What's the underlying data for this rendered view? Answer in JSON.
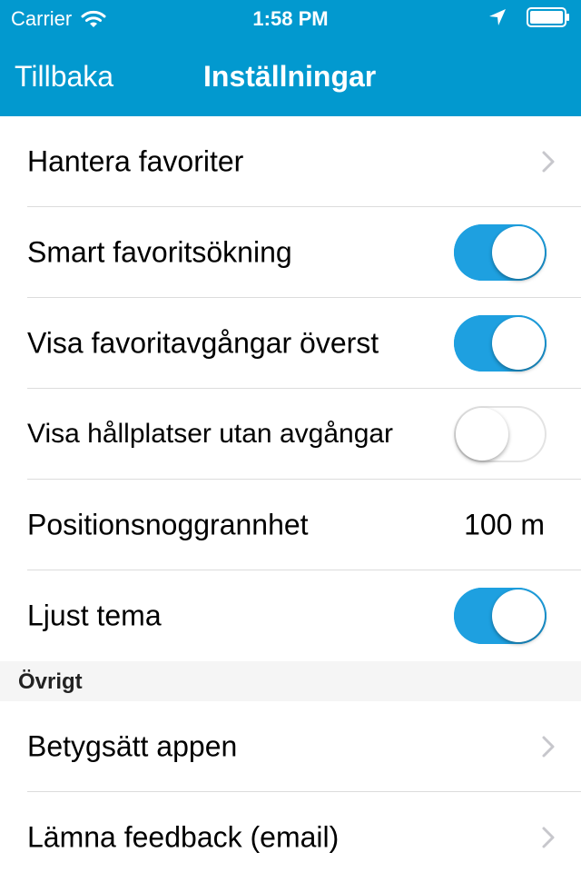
{
  "status_bar": {
    "carrier": "Carrier",
    "time": "1:58 PM"
  },
  "nav": {
    "back_label": "Tillbaka",
    "title": "Inställningar"
  },
  "settings": {
    "manage_favorites": "Hantera favoriter",
    "smart_search": {
      "label": "Smart favoritsökning",
      "on": true
    },
    "show_fav_departures_top": {
      "label": "Visa favoritavgångar överst",
      "on": true
    },
    "show_stops_without_departures": {
      "label": "Visa hållplatser utan avgångar",
      "on": false
    },
    "position_accuracy": {
      "label": "Positionsnoggrannhet",
      "value": "100 m"
    },
    "light_theme": {
      "label": "Ljust tema",
      "on": true
    }
  },
  "other_section": {
    "header": "Övrigt",
    "rate_app": "Betygsätt appen",
    "feedback": "Lämna feedback (email)"
  },
  "colors": {
    "nav_background": "#0299cf",
    "toggle_on": "#1ea0e0",
    "section_background": "#f5f5f5"
  },
  "icons": [
    "wifi-icon",
    "location-arrow-icon",
    "battery-icon",
    "chevron-right-icon"
  ]
}
